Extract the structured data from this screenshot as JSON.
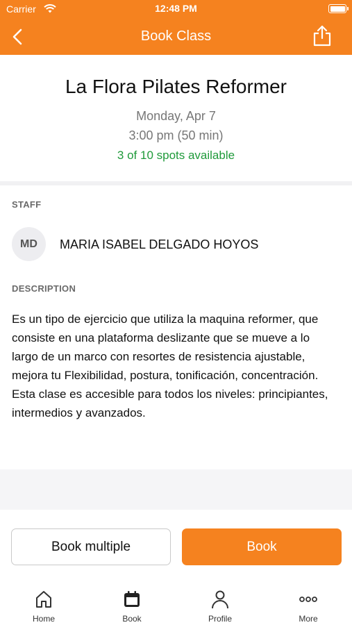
{
  "status_bar": {
    "carrier": "Carrier",
    "time": "12:48 PM"
  },
  "nav": {
    "title": "Book Class",
    "back_icon": "chevron-left-icon",
    "share_icon": "share-icon"
  },
  "class_info": {
    "name": "La Flora Pilates Reformer",
    "date": "Monday, Apr 7",
    "time": "3:00 pm (50 min)",
    "availability": "3 of 10 spots available"
  },
  "staff": {
    "label": "STAFF",
    "initials": "MD",
    "name": "MARIA ISABEL DELGADO HOYOS"
  },
  "description": {
    "label": "DESCRIPTION",
    "text": "Es un tipo de ejercicio que utiliza la maquina reformer, que consiste en una plataforma deslizante que se mueve a lo largo de un marco con resortes de resistencia ajustable, mejora tu Flexibilidad, postura, tonificación, concentración. Esta clase es accesible para todos los niveles: principiantes, intermedios y avanzados."
  },
  "actions": {
    "book_multiple": "Book multiple",
    "book": "Book"
  },
  "tabs": [
    {
      "label": "Home",
      "icon": "home-icon"
    },
    {
      "label": "Book",
      "icon": "calendar-icon"
    },
    {
      "label": "Profile",
      "icon": "user-icon"
    },
    {
      "label": "More",
      "icon": "more-dots-icon"
    }
  ],
  "colors": {
    "brand": "#f5821f",
    "availability": "#1f9a3a"
  }
}
